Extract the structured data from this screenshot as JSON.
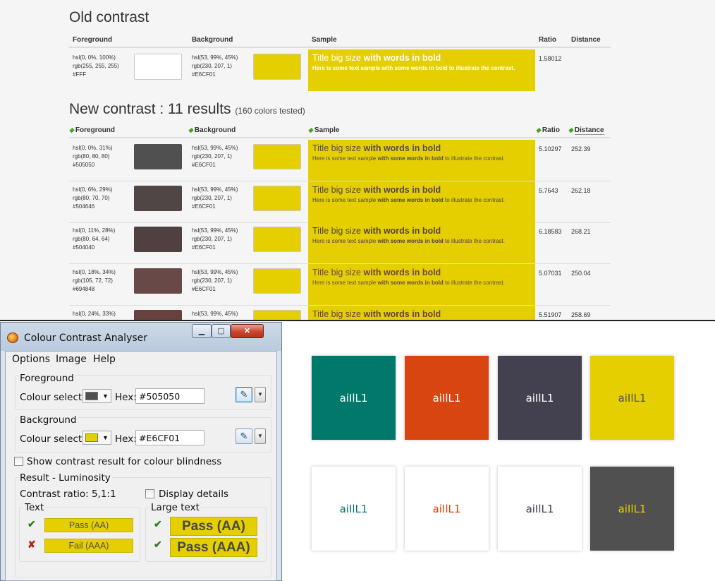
{
  "top": {
    "old_title": "Old contrast",
    "headers": {
      "foreground": "Foreground",
      "background": "Background",
      "sample": "Sample",
      "ratio": "Ratio",
      "distance": "Distance"
    },
    "old_row": {
      "fg_hsl": "hsl(0, 0%, 100%)",
      "fg_rgb": "rgb(255, 255, 255)",
      "fg_hex": "#FFF",
      "fg_color": "#ffffff",
      "bg_hsl": "hsl(53, 99%, 45%)",
      "bg_rgb": "rgb(230, 207, 1)",
      "bg_hex": "#E6CF01",
      "bg_color": "#e6cf01",
      "sample_title_plain": "Title big size ",
      "sample_title_bold": "with words in bold",
      "sample_desc_1": "Here is some text sample ",
      "sample_desc_2": "with some words in bold",
      "sample_desc_3": " to illustrate the contrast.",
      "sample_text_color": "#ffffff",
      "ratio": "1.58012",
      "distance": ""
    },
    "new_title": "New contrast : 11 results",
    "new_subtitle": "(160 colors tested)",
    "new_rows": [
      {
        "fg_hsl": "hsl(0, 0%, 31%)",
        "fg_rgb": "rgb(80, 80, 80)",
        "fg_hex": "#505050",
        "fg_color": "#505050",
        "bg_hsl": "hsl(53, 99%, 45%)",
        "bg_rgb": "rgb(230, 207, 1)",
        "bg_hex": "#E6CF01",
        "ratio": "5.10297",
        "distance": "252.39"
      },
      {
        "fg_hsl": "hsl(0, 6%, 29%)",
        "fg_rgb": "rgb(80, 70, 70)",
        "fg_hex": "#504646",
        "fg_color": "#504646",
        "bg_hsl": "hsl(53, 99%, 45%)",
        "bg_rgb": "rgb(230, 207, 1)",
        "bg_hex": "#E6CF01",
        "ratio": "5.7643",
        "distance": "262.18"
      },
      {
        "fg_hsl": "hsl(0, 11%, 28%)",
        "fg_rgb": "rgb(80, 64, 64)",
        "fg_hex": "#504040",
        "fg_color": "#504040",
        "bg_hsl": "hsl(53, 99%, 45%)",
        "bg_rgb": "rgb(230, 207, 1)",
        "bg_hex": "#E6CF01",
        "ratio": "6.18583",
        "distance": "268.21"
      },
      {
        "fg_hsl": "hsl(0, 18%, 34%)",
        "fg_rgb": "rgb(105, 72, 72)",
        "fg_hex": "#694848",
        "fg_color": "#694848",
        "bg_hsl": "hsl(53, 99%, 45%)",
        "bg_rgb": "rgb(230, 207, 1)",
        "bg_hex": "#E6CF01",
        "ratio": "5.07031",
        "distance": "250.04"
      },
      {
        "fg_hsl": "hsl(0, 24%, 33%)",
        "fg_rgb": "",
        "fg_hex": "",
        "fg_color": "#684040",
        "bg_hsl": "hsl(53, 99%, 45%)",
        "bg_rgb": "",
        "bg_hex": "",
        "ratio": "5.51907",
        "distance": "258.69"
      }
    ]
  },
  "cca": {
    "title": "Colour Contrast Analyser",
    "menu": [
      "Options",
      "Image",
      "Help"
    ],
    "foreground": {
      "label": "Foreground",
      "colour_select": "Colour select:",
      "hex_label": "Hex:",
      "hex": "#505050",
      "swatch": "#505050"
    },
    "background": {
      "label": "Background",
      "colour_select": "Colour select:",
      "hex_label": "Hex:",
      "hex": "#E6CF01",
      "swatch": "#e6cf01"
    },
    "blindness_label": "Show contrast result for colour blindness",
    "result_label": "Result - Luminosity",
    "contrast_ratio": "Contrast ratio: 5,1:1",
    "display_details": "Display details",
    "text_label": "Text",
    "large_text_label": "Large text",
    "text_results": [
      "Pass (AA)",
      "Fail (AAA)"
    ],
    "large_results": [
      "Pass (AA)",
      "Pass (AAA)"
    ],
    "pass_color": "#2e7d1f",
    "fail_color": "#b3201a"
  },
  "tiles": [
    {
      "text": "aiIlL1",
      "bg": "#00796b",
      "fg": "#ffffff"
    },
    {
      "text": "aiIlL1",
      "bg": "#d84510",
      "fg": "#ffffff"
    },
    {
      "text": "aiIlL1",
      "bg": "#434150",
      "fg": "#ffffff"
    },
    {
      "text": "aiIlL1",
      "bg": "#e6cf01",
      "fg": "#505050"
    },
    {
      "text": "aiIlL1",
      "bg": "#ffffff",
      "fg": "#00796b"
    },
    {
      "text": "aiIlL1",
      "bg": "#ffffff",
      "fg": "#d84510"
    },
    {
      "text": "aiIlL1",
      "bg": "#ffffff",
      "fg": "#434150"
    },
    {
      "text": "aiIlL1",
      "bg": "#505050",
      "fg": "#e6cf01"
    }
  ]
}
